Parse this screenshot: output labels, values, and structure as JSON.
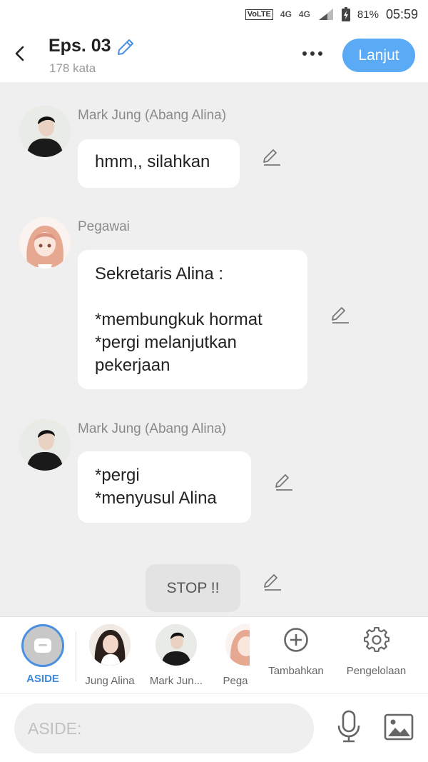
{
  "status_bar": {
    "volte": "VoLTE",
    "network_left": "4G",
    "network_right": "4G",
    "battery": "81%",
    "time": "05:59"
  },
  "header": {
    "title": "Eps. 03",
    "word_count": "178 kata",
    "next_label": "Lanjut",
    "accent": "#5aaaf5"
  },
  "messages": [
    {
      "sender": "Mark Jung (Abang Alina)",
      "text": "hmm,, silahkan",
      "avatar": "man-black-hoodie"
    },
    {
      "sender": "Pegawai",
      "text": "Sekretaris Alina :\n\n*membungkuk hormat\n*pergi melanjutkan pekerjaan",
      "avatar": "anime-girl-pink-hair"
    },
    {
      "sender": "Mark Jung (Abang Alina)",
      "text": "*pergi\n*menyusul Alina",
      "avatar": "man-black-hoodie"
    }
  ],
  "aside_message": {
    "text": "STOP !!"
  },
  "characters": [
    {
      "label": "ASIDE",
      "selected": true,
      "icon": "aside-icon"
    },
    {
      "label": "Jung Alina",
      "avatar": "woman-portrait"
    },
    {
      "label": "Mark Jun...",
      "avatar": "man-black-hoodie"
    },
    {
      "label": "Pega",
      "avatar": "anime-girl-pink-hair"
    }
  ],
  "tools": {
    "add_label": "Tambahkan",
    "manage_label": "Pengelolaan"
  },
  "input": {
    "placeholder": "ASIDE:"
  }
}
